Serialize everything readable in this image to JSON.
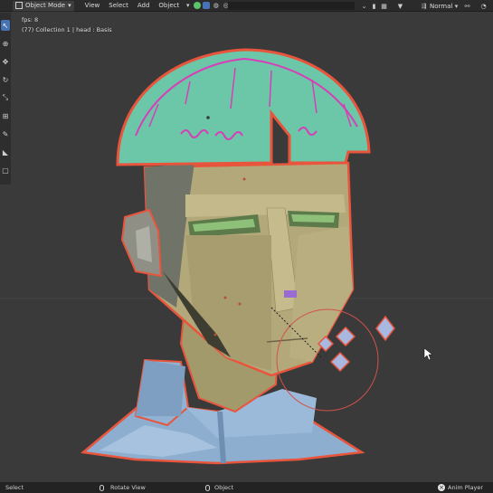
{
  "header": {
    "mode_label": "Object Mode",
    "menus": [
      "View",
      "Select",
      "Add",
      "Object"
    ],
    "shading_label": "Normal"
  },
  "viewport": {
    "fps_text": "fps: 8",
    "info_text": "(77) Collection 1 | head : Basis"
  },
  "status": {
    "select_label": "Select",
    "rotate_label": "Rotate View",
    "object_label": "Object",
    "anim_label": "Anim Player"
  },
  "colors": {
    "background": "#3a3a3a",
    "selection_outline": "#e8553c",
    "hair": "#6cc6a8",
    "hair_accent": "#d63fb8",
    "skin": "#b6ab7b",
    "collar": "#8fb3d6"
  },
  "icons": {
    "tools": [
      "select-cursor-icon",
      "cursor-icon",
      "move-icon",
      "rotate-icon",
      "scale-icon",
      "transform-icon",
      "annotate-icon",
      "measure-icon",
      "add-cube-icon"
    ]
  }
}
